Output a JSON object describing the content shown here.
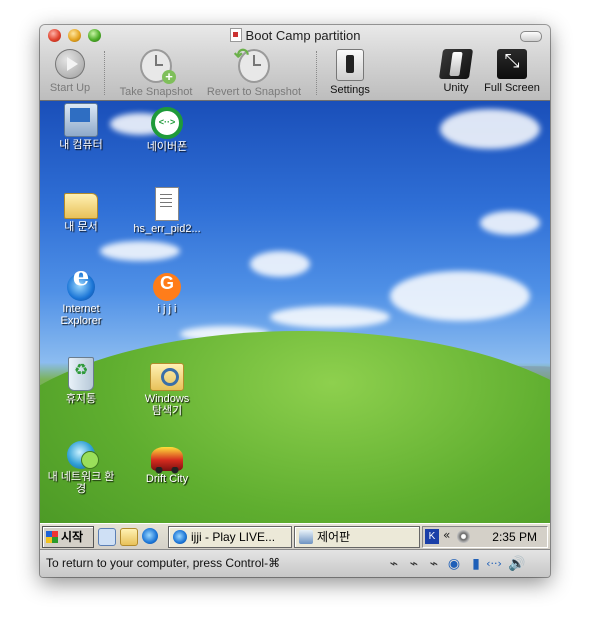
{
  "window": {
    "title": "Boot Camp partition"
  },
  "toolbar": {
    "start_up": "Start Up",
    "take_snapshot": "Take Snapshot",
    "revert_to_snapshot": "Revert to Snapshot",
    "settings": "Settings",
    "unity": "Unity",
    "full_screen": "Full Screen"
  },
  "desktop": {
    "icons": [
      {
        "label": "내 컴퓨터",
        "icon": "my-computer-icon"
      },
      {
        "label": "네이버폰",
        "icon": "naver-phone-icon"
      },
      {
        "label": "내 문서",
        "icon": "my-documents-icon"
      },
      {
        "label": "hs_err_pid2...",
        "icon": "text-file-icon"
      },
      {
        "label": "Internet Explorer",
        "icon": "internet-explorer-icon"
      },
      {
        "label": "i j j i",
        "icon": "ijji-icon"
      },
      {
        "label": "휴지통",
        "icon": "recycle-bin-icon"
      },
      {
        "label": "Windows 탐색기",
        "icon": "windows-explorer-icon"
      },
      {
        "label": "내 네트워크 환경",
        "icon": "network-places-icon"
      },
      {
        "label": "Drift City",
        "icon": "drift-city-icon"
      }
    ]
  },
  "taskbar": {
    "start": "시작",
    "tasks": [
      {
        "label": "ijji - Play LIVE...",
        "icon": "internet-explorer-icon"
      },
      {
        "label": "제어판",
        "icon": "control-panel-icon"
      }
    ],
    "tray": {
      "ime": "K",
      "clock": "2:35 PM"
    }
  },
  "statusbar": {
    "message": "To return to your computer, press Control-⌘"
  },
  "colors": {
    "accent_blue": "#1e5fb8",
    "traffic_close": "#e0442f",
    "traffic_minimize": "#e5a523",
    "traffic_zoom": "#4fae2a"
  }
}
